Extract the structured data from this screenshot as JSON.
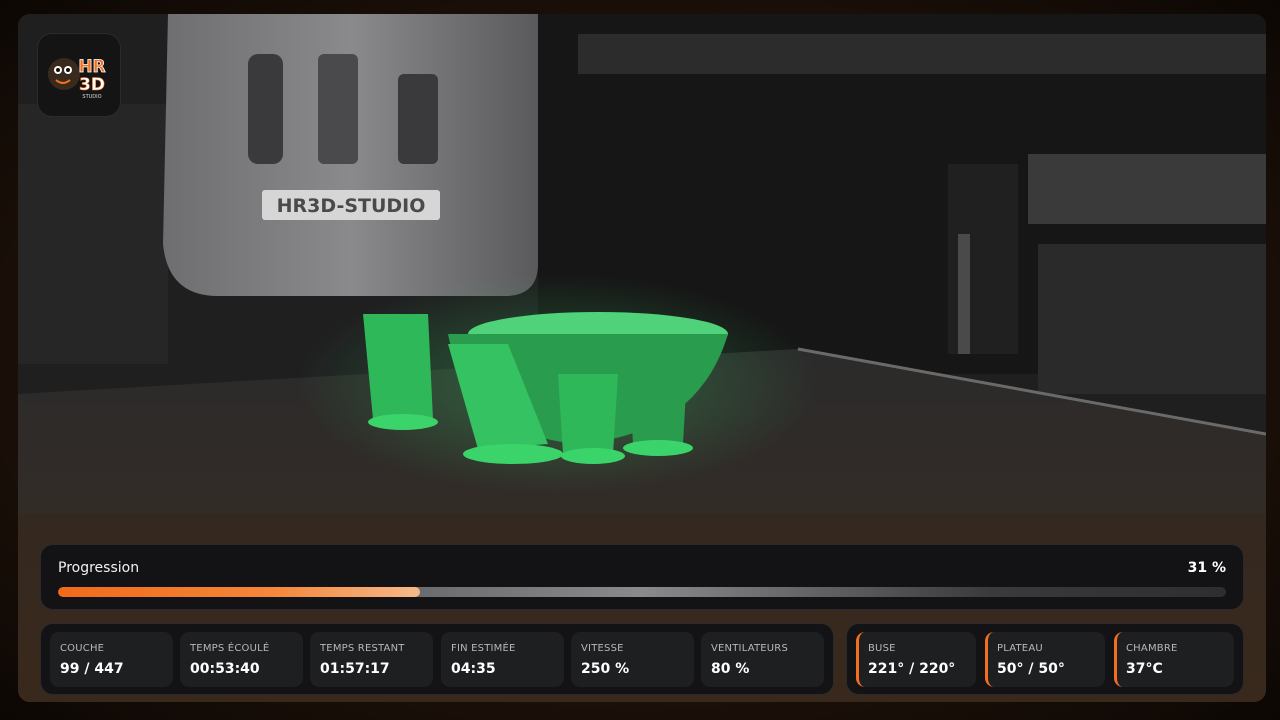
{
  "logo": {
    "text_top": "HR",
    "text_bottom": "3D",
    "text_sub": "STUDIO"
  },
  "camera": {
    "printhead_label": "HR3D-STUDIO",
    "filament_color": "#2ec25a"
  },
  "progress": {
    "label": "Progression",
    "value_text": "31 %",
    "fraction": 0.31,
    "accent": "#f06a1a"
  },
  "stats": [
    {
      "key": "layer",
      "label": "COUCHE",
      "value": "99 / 447"
    },
    {
      "key": "elapsed",
      "label": "TEMPS ÉCOULÉ",
      "value": "00:53:40"
    },
    {
      "key": "remaining",
      "label": "TEMPS RESTANT",
      "value": "01:57:17"
    },
    {
      "key": "eta",
      "label": "FIN ESTIMÉE",
      "value": "04:35"
    },
    {
      "key": "speed",
      "label": "VITESSE",
      "value": "250 %"
    },
    {
      "key": "fans",
      "label": "VENTILATEURS",
      "value": "80 %"
    }
  ],
  "temperatures": [
    {
      "key": "nozzle",
      "label": "BUSE",
      "value": "221° / 220°"
    },
    {
      "key": "bed",
      "label": "PLATEAU",
      "value": "50° / 50°"
    },
    {
      "key": "chamber",
      "label": "CHAMBRE",
      "value": "37°C"
    }
  ]
}
